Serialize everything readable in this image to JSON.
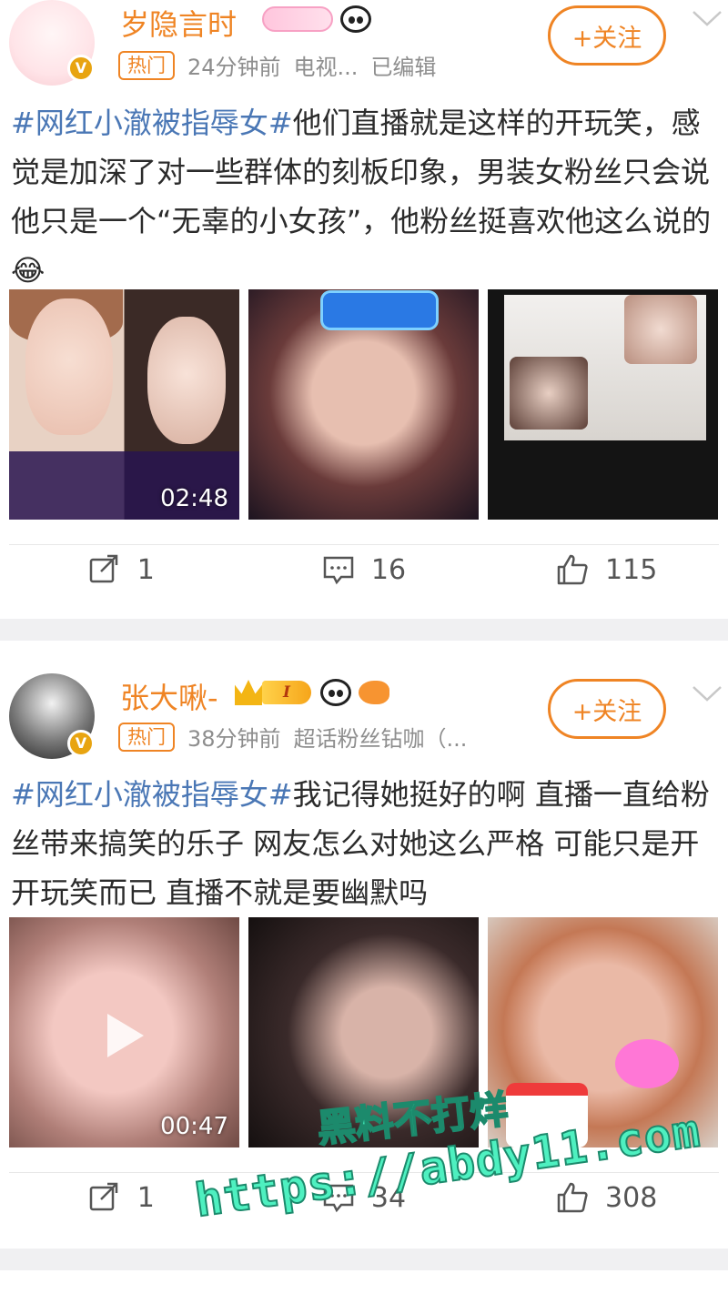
{
  "posts": [
    {
      "username": "岁隐言时",
      "hot_tag": "热门",
      "time": "24分钟前",
      "source": "电视...",
      "edited": "已编辑",
      "follow_label": "+关注",
      "hashtag": "#网红小澈被指辱女#",
      "text": "他们直播就是这样的开玩笑，感觉是加深了对一些群体的刻板印象，男装女粉丝只会说他只是一个“无辜的小女孩”，他粉丝挺喜欢他这么说的😂",
      "video_duration": "02:48",
      "reposts": "1",
      "comments": "16",
      "likes": "115"
    },
    {
      "username": "张大啾-",
      "hot_tag": "热门",
      "time": "38分钟前",
      "source": "超话粉丝钻咖（...",
      "level_badge": "I",
      "follow_label": "+关注",
      "hashtag": "#网红小澈被指辱女#",
      "text": "我记得她挺好的啊 直播一直给粉丝带来搞笑的乐子 网友怎么对她这么严格 可能只是开开玩笑而已 直播不就是要幽默吗",
      "video_duration": "00:47",
      "reposts": "1",
      "comments": "34",
      "likes": "308"
    }
  ],
  "watermark": {
    "line1": "黑料不打烊",
    "line2": "https://abdy11.com"
  },
  "icons": {
    "repost": "repost-icon",
    "comment": "comment-icon",
    "like": "like-icon"
  },
  "colors": {
    "brand_orange": "#ef8424",
    "hashtag_blue": "#4a77b5"
  }
}
